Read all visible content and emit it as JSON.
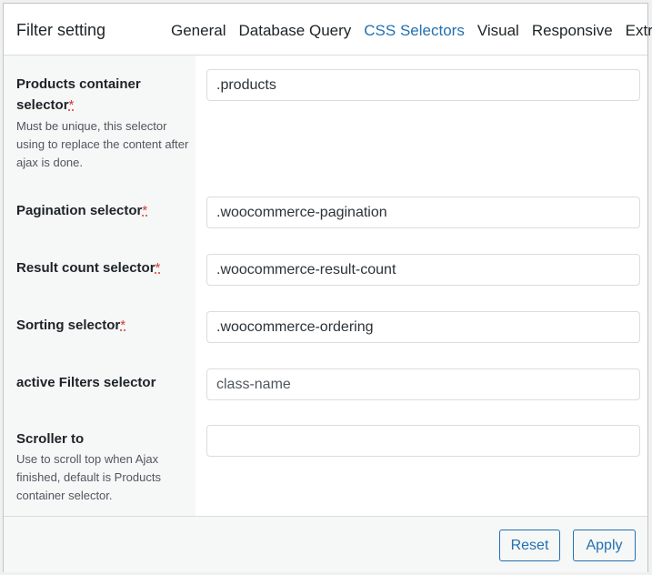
{
  "header": {
    "title": "Filter setting",
    "tabs": [
      "General",
      "Database Query",
      "CSS Selectors",
      "Visual",
      "Responsive",
      "Extra"
    ],
    "active_tab": "CSS Selectors"
  },
  "fields": {
    "products": {
      "label": "Products container selector",
      "required": "*",
      "description": "Must be unique, this selector using to replace the content after ajax is done.",
      "value": ".products"
    },
    "pagination": {
      "label": "Pagination selector",
      "required": "*",
      "value": ".woocommerce-pagination"
    },
    "result_count": {
      "label": "Result count selector",
      "required": "*",
      "value": ".woocommerce-result-count"
    },
    "sorting": {
      "label": "Sorting selector",
      "required": "*",
      "value": ".woocommerce-ordering"
    },
    "active_filters": {
      "label": "active Filters selector",
      "placeholder": "class-name"
    },
    "scroller": {
      "label": "Scroller to",
      "description": "Use to scroll top when Ajax finished, default is Products container selector.",
      "value": ""
    }
  },
  "footer": {
    "reset_label": "Reset",
    "apply_label": "Apply"
  },
  "colors": {
    "accent": "#2271b1",
    "required": "#d63638",
    "label_bg": "#f6f7f7"
  }
}
